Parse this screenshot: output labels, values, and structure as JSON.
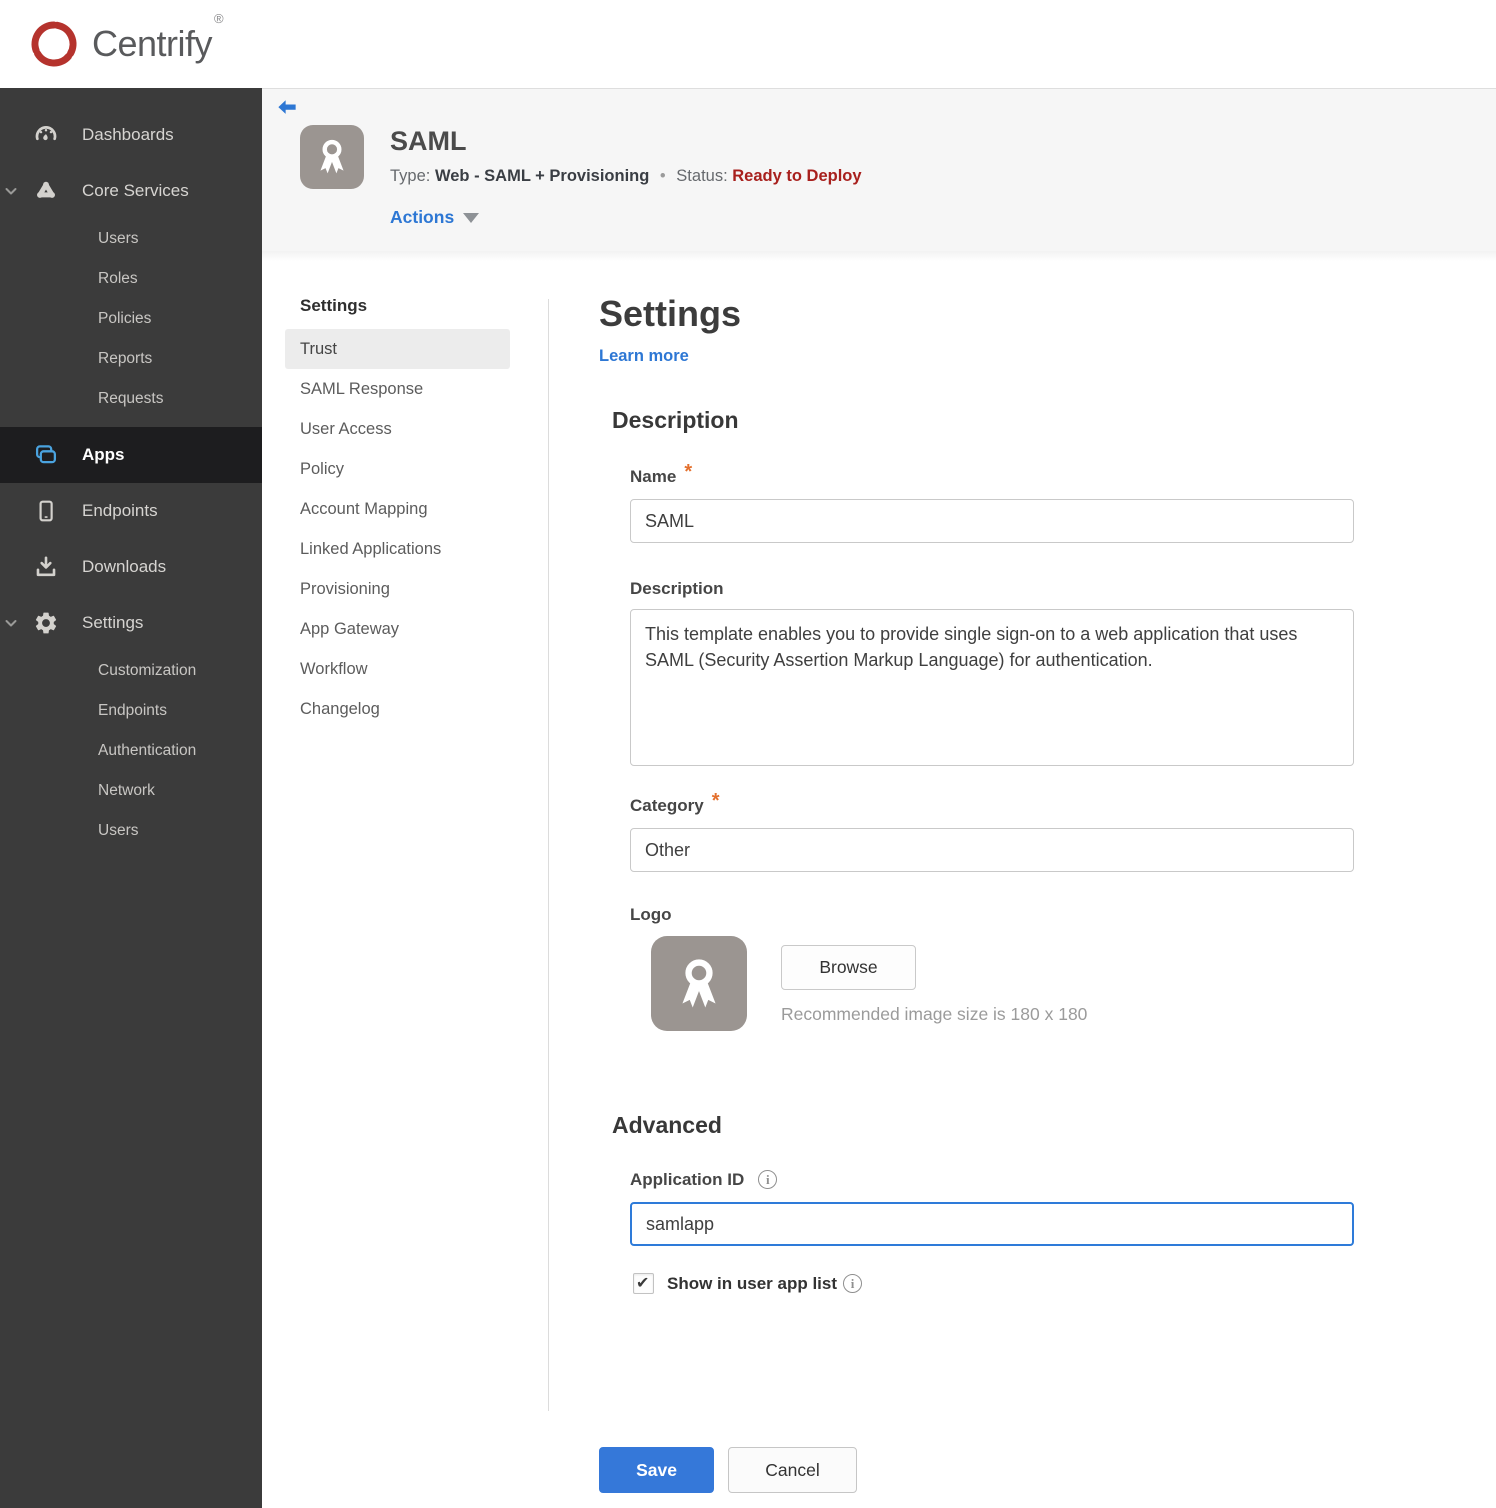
{
  "brand": {
    "name": "Centrify",
    "registered_mark": "®"
  },
  "sidebar": {
    "items": [
      {
        "label": "Dashboards",
        "icon": "gauge-icon"
      },
      {
        "label": "Core Services",
        "icon": "core-services-icon",
        "expanded": true,
        "children": [
          {
            "label": "Users"
          },
          {
            "label": "Roles"
          },
          {
            "label": "Policies"
          },
          {
            "label": "Reports"
          },
          {
            "label": "Requests"
          }
        ]
      },
      {
        "label": "Apps",
        "icon": "apps-icon",
        "active": true
      },
      {
        "label": "Endpoints",
        "icon": "device-icon"
      },
      {
        "label": "Downloads",
        "icon": "download-icon"
      },
      {
        "label": "Settings",
        "icon": "gear-icon",
        "expanded": true,
        "children": [
          {
            "label": "Customization"
          },
          {
            "label": "Endpoints"
          },
          {
            "label": "Authentication"
          },
          {
            "label": "Network"
          },
          {
            "label": "Users"
          }
        ]
      }
    ]
  },
  "app_header": {
    "title": "SAML",
    "type_label": "Type:",
    "type_value": "Web - SAML + Provisioning",
    "dot_separator": "•",
    "status_label": "Status:",
    "status_value": "Ready to Deploy",
    "actions_label": "Actions"
  },
  "subnav": {
    "title": "Settings",
    "items": [
      {
        "label": "Trust",
        "selected": true
      },
      {
        "label": "SAML Response"
      },
      {
        "label": "User Access"
      },
      {
        "label": "Policy"
      },
      {
        "label": "Account Mapping"
      },
      {
        "label": "Linked Applications"
      },
      {
        "label": "Provisioning"
      },
      {
        "label": "App Gateway"
      },
      {
        "label": "Workflow"
      },
      {
        "label": "Changelog"
      }
    ]
  },
  "form": {
    "title": "Settings",
    "learn_more_label": "Learn more",
    "required_marker": "*",
    "description_section": {
      "heading": "Description",
      "name": {
        "label": "Name",
        "value": "SAML",
        "required": true
      },
      "description": {
        "label": "Description",
        "value": "This template enables you to provide single sign-on to a web application that uses SAML (Security Assertion Markup Language) for authentication."
      },
      "category": {
        "label": "Category",
        "value": "Other",
        "required": true
      },
      "logo": {
        "label": "Logo",
        "browse_label": "Browse",
        "hint": "Recommended image size is 180 x 180"
      }
    },
    "advanced_section": {
      "heading": "Advanced",
      "application_id": {
        "label": "Application ID",
        "value": "samlapp",
        "focused": true
      },
      "show_in_user_app_list": {
        "label": "Show in user app list",
        "checked": true
      }
    },
    "buttons": {
      "save_label": "Save",
      "cancel_label": "Cancel"
    }
  },
  "colors": {
    "accent_blue": "#2d77d4",
    "save_blue": "#3578d9",
    "status_red": "#a8201d",
    "required_orange": "#e4702d",
    "brand_red": "#b5332d",
    "sidebar_bg": "#3b3b3b",
    "sidebar_active_bg": "#1d1d1f",
    "apps_icon_blue": "#4aa3df",
    "header_band_bg": "#f6f6f6",
    "logo_tile_gray": "#9b9591"
  }
}
